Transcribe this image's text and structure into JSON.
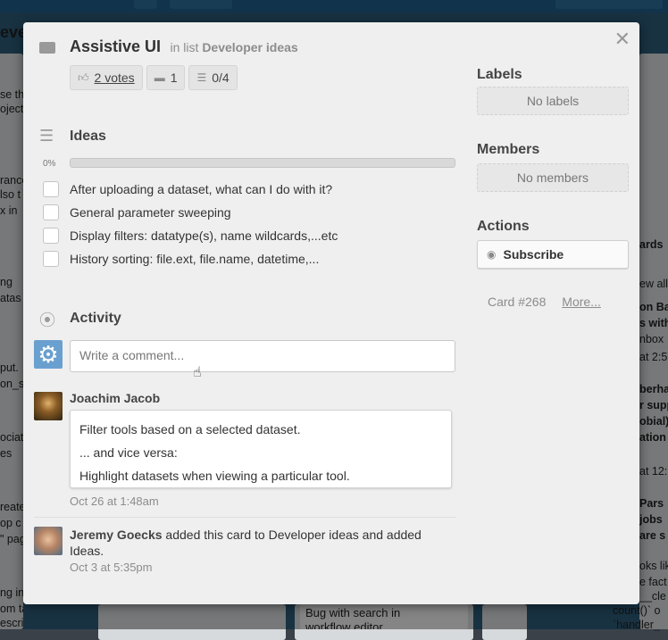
{
  "background": {
    "board_title_fragment": "evel",
    "left_column_fragments": [
      "se th",
      "oject.",
      "rance",
      "lso t",
      "x in",
      "ng",
      "atas",
      "put.",
      "on_s",
      "ociat",
      "es",
      "reate",
      "op c",
      "\" pag",
      "ng in",
      "om tab",
      "escription"
    ],
    "right_column_fragments": [
      "ards",
      "ew all",
      "on Ba",
      "s with",
      "nbox",
      "at 2:5",
      "berha",
      "r supp",
      "obial)",
      "ation",
      "at 12:",
      "Pars",
      "jobs",
      "are s",
      "oks lik",
      "e fact",
      "__cle",
      "count()` o",
      "`handler_"
    ],
    "bottom_cards": [
      "Bug with search in",
      "workflow editor"
    ]
  },
  "modal": {
    "title": "Assistive UI",
    "in_list_prefix": "in list",
    "list_name": "Developer ideas",
    "close_label": "✕",
    "badges": {
      "votes": "2 votes",
      "comments": "1",
      "checklist": "0/4"
    },
    "checklist": {
      "title": "Ideas",
      "progress_label": "0%",
      "progress_fraction": 0,
      "items": [
        "After uploading a dataset, what can I do with it?",
        "General parameter sweeping",
        "Display filters: datatype(s), name wildcards,...etc",
        "History sorting: file.ext, file.name, datetime,..."
      ]
    },
    "activity": {
      "title": "Activity",
      "comment_placeholder": "Write a comment...",
      "comment": {
        "author": "Joachim Jacob",
        "lines": [
          "Filter tools based on a selected dataset.",
          "... and vice versa:",
          "Highlight datasets when viewing a particular tool."
        ],
        "time": "Oct 26 at 1:48am"
      },
      "action": {
        "actor": "Jeremy Goecks",
        "text": " added this card to Developer ideas and added Ideas.",
        "time": "Oct 3 at 5:35pm"
      }
    },
    "sidebar": {
      "labels_title": "Labels",
      "labels_empty": "No labels",
      "members_title": "Members",
      "members_empty": "No members",
      "actions_title": "Actions",
      "subscribe_label": "Subscribe",
      "card_number": "Card #268",
      "more_label": "More..."
    }
  }
}
